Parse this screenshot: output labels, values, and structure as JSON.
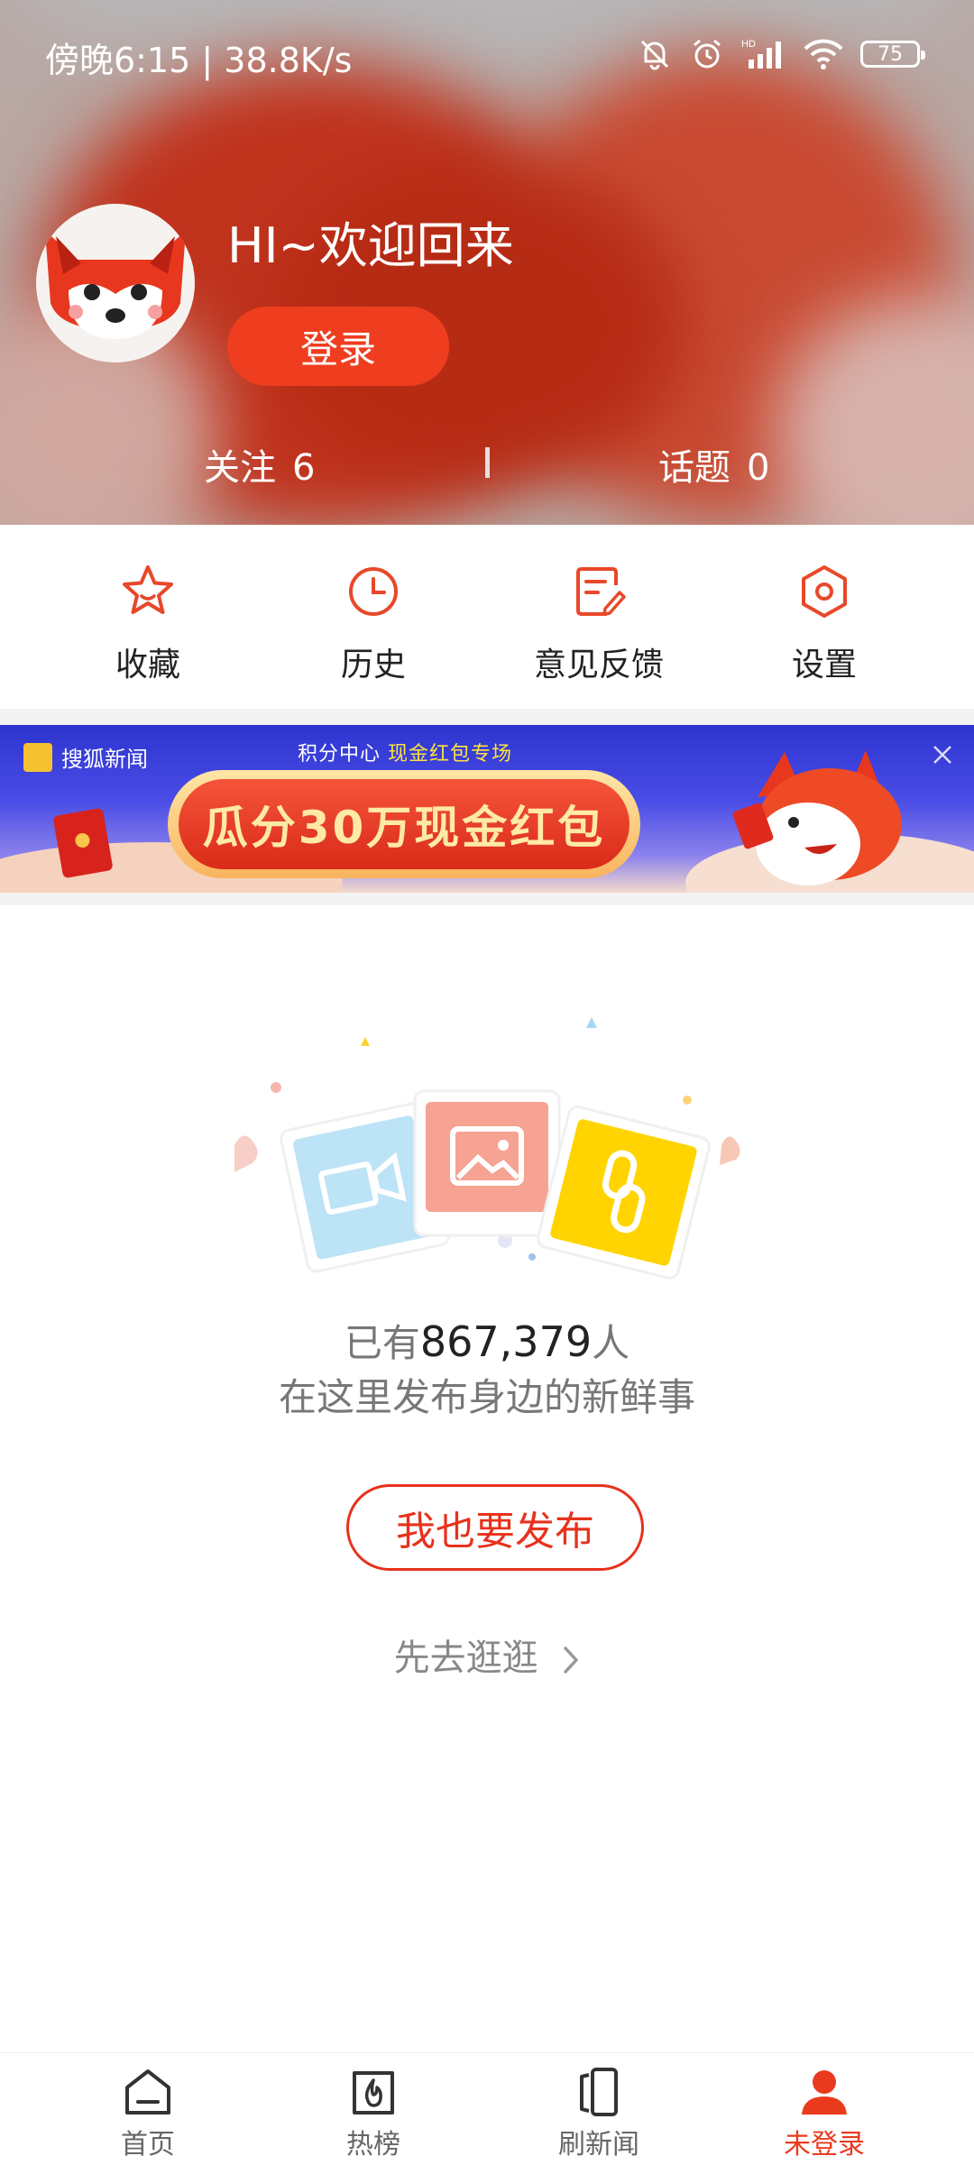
{
  "status_bar": {
    "time": "傍晚6:15 | 38.8K/s",
    "battery": "75"
  },
  "profile": {
    "welcome": "HI~欢迎回来",
    "login_label": "登录",
    "follow_label": "关注",
    "follow_count": "6",
    "topic_label": "话题",
    "topic_count": "0"
  },
  "quick_actions": [
    {
      "label": "收藏",
      "icon": "star-icon"
    },
    {
      "label": "历史",
      "icon": "clock-icon"
    },
    {
      "label": "意见反馈",
      "icon": "feedback-icon"
    },
    {
      "label": "设置",
      "icon": "settings-icon"
    }
  ],
  "banner": {
    "brand": "搜狐新闻",
    "subtitle_prefix": "积分中心",
    "subtitle_highlight": "现金红包专场",
    "headline": "瓜分30万现金红包"
  },
  "empty_state": {
    "count_prefix": "已有",
    "count": "867,379",
    "count_suffix": "人",
    "description": "在这里发布身边的新鲜事",
    "publish_label": "我也要发布",
    "browse_label": "先去逛逛"
  },
  "bottom_nav": [
    {
      "label": "首页",
      "icon": "home-icon",
      "active": false
    },
    {
      "label": "热榜",
      "icon": "hot-list-icon",
      "active": false
    },
    {
      "label": "刷新闻",
      "icon": "cards-icon",
      "active": false
    },
    {
      "label": "未登录",
      "icon": "user-icon",
      "active": true
    }
  ],
  "colors": {
    "accent": "#ea3a1e",
    "header_red": "#c0331d"
  }
}
